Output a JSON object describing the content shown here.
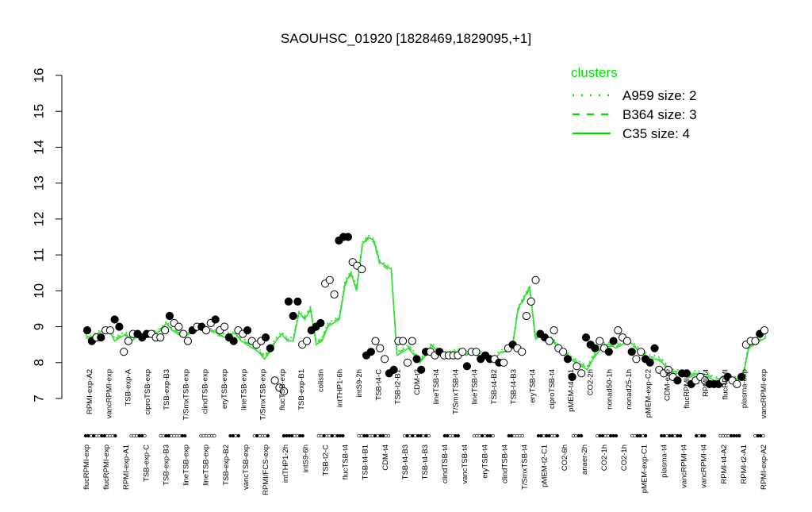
{
  "chart_data": {
    "type": "line",
    "title": "SAOUHSC_01920 [1828469,1829095,+1]",
    "ylim": [
      7,
      16
    ],
    "yticks": [
      7,
      8,
      9,
      10,
      11,
      12,
      13,
      14,
      15,
      16
    ],
    "grid": false,
    "legend_position": "top-right",
    "legend": {
      "title": "clusters",
      "color": "#00dd00",
      "entries": [
        {
          "label": "A959 size: 2",
          "style": "dotted"
        },
        {
          "label": "B364 size: 3",
          "style": "dashed"
        },
        {
          "label": "C35 size: 4",
          "style": "solid"
        }
      ]
    },
    "line_color": "#33dd33",
    "labels_upper": [
      "RPMI-exp-A2",
      "vancRPMI-exp",
      "TSB-exp-A",
      "ciproTSB-exp",
      "TSB-exp-B3",
      "T/SmxTSB-exp",
      "clindTSB-exp",
      "eryTSB-exp",
      "lineTSB-exp",
      "T/SmxTSB-exp",
      "flucTSB-exp",
      "TSB-exp-B1",
      "colistin",
      "intTHP1-6h",
      "intS9-2h",
      "TSB-t4-C",
      "TSB-t2-B1",
      "CDM-t2",
      "lineTSB-t4",
      "T/SmxTSB-t4",
      "lineTSB-t4",
      "TSB-t4-B2",
      "TSB-t4-B3",
      "eryTSB-t4",
      "ciproTSB-t4",
      "pMEM-t4-C1",
      "CO2-2h",
      "nonad50-1h",
      "nonad25-1h",
      "pMEM-exp-C2",
      "CDM-exp",
      "flucRPMI-t4",
      "RPMI-t4",
      "flucRPMI",
      "plasma-exp",
      "vancRPMI-exp"
    ],
    "labels_lower": [
      "flucRPMI-exp",
      "flucRPMI-exp",
      "RPMI-exp-A1",
      "TSB-exp-C",
      "TSB-exp-B3",
      "lineTSB-exp",
      "lineTSB-exp",
      "TSB-exp-B2",
      "vancTSB-exp",
      "RPMI/FCS-exp",
      "intTHP1-2h",
      "intS9-6h",
      "TSB-t2-C",
      "flucTSB-t4",
      "TSB-t4-B1",
      "CDM-t4",
      "TSB-t4-B3",
      "TSB-t4-B3",
      "clindTSB-t4",
      "vancTSB-t4",
      "eryTSB-t4",
      "clindTSB-t4",
      "T/SmxTSB-t4",
      "pMEM-t2-C1",
      "CO2-6h",
      "anaer-2h",
      "CO2-1h",
      "CO2-1h",
      "pMEM-exp-C1",
      "plasma-t4",
      "vancRPMI-t4",
      "vancRPMI-t4",
      "RPMI-t4-A2",
      "RPMI-t2-A1",
      "RPMI-exp-A2"
    ],
    "series": [
      {
        "style": "solid",
        "values": [
          8.75,
          8.7,
          8.8,
          8.9,
          8.95,
          8.6,
          8.7,
          8.8,
          8.6,
          8.75,
          8.7,
          8.7,
          8.8,
          8.9,
          9.1,
          8.9,
          8.8,
          8.7,
          8.8,
          8.9,
          9.0,
          8.9,
          8.9,
          8.8,
          8.7,
          8.8,
          8.8,
          8.6,
          8.5,
          8.4,
          8.3,
          8.1,
          8.3,
          8.6,
          8.8,
          8.6,
          8.6,
          9.4,
          9.2,
          9.5,
          8.5,
          8.6,
          9.0,
          9.1,
          9.2,
          10.2,
          10.5,
          10.0,
          11.3,
          11.5,
          11.4,
          10.8,
          10.7,
          10.6,
          8.2,
          8.3,
          8.4,
          8.2,
          8.0,
          8.2,
          8.5,
          8.3,
          8.2,
          8.2,
          8.3,
          8.3,
          8.2,
          8.3,
          8.2,
          8.2,
          8.1,
          8.1,
          8.3,
          8.3,
          8.4,
          9.5,
          9.8,
          10.1,
          8.7,
          8.8,
          8.7,
          8.6,
          8.4,
          8.3,
          8.1,
          8.0,
          7.9,
          7.8,
          8.1,
          8.3,
          8.5,
          8.5,
          8.4,
          8.5,
          8.6,
          8.5,
          8.3,
          8.2,
          8.1,
          8.1,
          8.0,
          7.8,
          7.7,
          7.7,
          7.6,
          7.6,
          7.7,
          7.6,
          7.6,
          7.5,
          7.5,
          7.5,
          7.5,
          7.5,
          7.6,
          8.4,
          8.5,
          8.6,
          8.7
        ]
      },
      {
        "style": "dashed",
        "values": [
          8.7,
          8.65,
          8.75,
          8.85,
          8.9,
          8.65,
          8.75,
          8.75,
          8.65,
          8.7,
          8.75,
          8.75,
          8.85,
          8.95,
          9.05,
          8.95,
          8.85,
          8.75,
          8.85,
          8.85,
          8.95,
          8.95,
          8.85,
          8.75,
          8.75,
          8.75,
          8.75,
          8.65,
          8.55,
          8.45,
          8.35,
          8.15,
          8.35,
          8.65,
          8.75,
          8.65,
          8.65,
          9.35,
          9.25,
          9.45,
          8.55,
          8.65,
          9.05,
          9.15,
          9.25,
          10.15,
          10.45,
          10.05,
          11.25,
          11.45,
          11.35,
          10.75,
          10.65,
          10.55,
          8.25,
          8.35,
          8.45,
          8.25,
          8.05,
          8.25,
          8.45,
          8.35,
          8.25,
          8.25,
          8.35,
          8.35,
          8.25,
          8.25,
          8.25,
          8.25,
          8.15,
          8.15,
          8.25,
          8.35,
          8.45,
          9.45,
          9.75,
          10.05,
          8.65,
          8.75,
          8.65,
          8.65,
          8.45,
          8.35,
          8.15,
          8.05,
          7.95,
          7.85,
          8.15,
          8.35,
          8.45,
          8.45,
          8.45,
          8.55,
          8.55,
          8.45,
          8.35,
          8.25,
          8.15,
          8.15,
          8.05,
          7.85,
          7.75,
          7.75,
          7.65,
          7.65,
          7.75,
          7.65,
          7.65,
          7.55,
          7.55,
          7.55,
          7.55,
          7.55,
          7.65,
          8.45,
          8.55,
          8.65,
          8.75
        ]
      },
      {
        "style": "dotted",
        "values": [
          8.8,
          8.75,
          8.85,
          8.95,
          8.9,
          8.7,
          8.8,
          8.85,
          8.7,
          8.8,
          8.8,
          8.75,
          8.9,
          8.95,
          9.15,
          8.95,
          8.85,
          8.8,
          8.85,
          8.95,
          9.0,
          8.95,
          8.95,
          8.85,
          8.8,
          8.85,
          8.85,
          8.7,
          8.6,
          8.5,
          8.4,
          8.2,
          8.4,
          8.7,
          8.85,
          8.7,
          8.7,
          9.45,
          9.3,
          9.55,
          8.6,
          8.7,
          9.1,
          9.2,
          9.3,
          10.3,
          10.55,
          10.1,
          11.35,
          11.55,
          11.45,
          10.85,
          10.75,
          10.65,
          8.3,
          8.4,
          8.5,
          8.3,
          8.1,
          8.3,
          8.55,
          8.4,
          8.3,
          8.3,
          8.35,
          8.4,
          8.3,
          8.35,
          8.3,
          8.3,
          8.2,
          8.2,
          8.35,
          8.4,
          8.5,
          9.55,
          9.85,
          10.15,
          8.75,
          8.85,
          8.75,
          8.7,
          8.5,
          8.4,
          8.2,
          8.1,
          8.0,
          7.9,
          8.2,
          8.4,
          8.55,
          8.55,
          8.5,
          8.6,
          8.65,
          8.55,
          8.4,
          8.3,
          8.2,
          8.2,
          8.1,
          7.9,
          7.8,
          7.8,
          7.7,
          7.7,
          7.8,
          7.7,
          7.7,
          7.6,
          7.6,
          7.6,
          7.6,
          7.6,
          7.7,
          8.5,
          8.6,
          8.7,
          8.8
        ]
      }
    ],
    "points": [
      {
        "v": 8.9,
        "f": 1
      },
      {
        "v": 8.6,
        "f": 1
      },
      {
        "v": 8.7,
        "f": 0
      },
      {
        "v": 8.7,
        "f": 1
      },
      {
        "v": 8.9,
        "f": 0
      },
      {
        "v": 8.9,
        "f": 0
      },
      {
        "v": 9.2,
        "f": 1
      },
      {
        "v": 9.0,
        "f": 1
      },
      {
        "v": 8.3,
        "f": 0
      },
      {
        "v": 8.6,
        "f": 0
      },
      {
        "v": 8.8,
        "f": 0
      },
      {
        "v": 8.8,
        "f": 1
      },
      {
        "v": 8.7,
        "f": 1
      },
      {
        "v": 8.8,
        "f": 1
      },
      {
        "v": 8.8,
        "f": 0
      },
      {
        "v": 8.7,
        "f": 0
      },
      {
        "v": 8.7,
        "f": 0
      },
      {
        "v": 8.9,
        "f": 0
      },
      {
        "v": 9.3,
        "f": 1
      },
      {
        "v": 9.1,
        "f": 0
      },
      {
        "v": 9.0,
        "f": 0
      },
      {
        "v": 8.8,
        "f": 0
      },
      {
        "v": 8.6,
        "f": 0
      },
      {
        "v": 8.9,
        "f": 1
      },
      {
        "v": 9.0,
        "f": 0
      },
      {
        "v": 9.0,
        "f": 1
      },
      {
        "v": 8.9,
        "f": 0
      },
      {
        "v": 9.1,
        "f": 0
      },
      {
        "v": 9.2,
        "f": 1
      },
      {
        "v": 8.9,
        "f": 0
      },
      {
        "v": 9.0,
        "f": 0
      },
      {
        "v": 8.7,
        "f": 1
      },
      {
        "v": 8.6,
        "f": 1
      },
      {
        "v": 8.9,
        "f": 0
      },
      {
        "v": 8.8,
        "f": 0
      },
      {
        "v": 8.9,
        "f": 1
      },
      {
        "v": 8.6,
        "f": 0
      },
      {
        "v": 8.5,
        "f": 0
      },
      {
        "v": 8.6,
        "f": 0
      },
      {
        "v": 8.7,
        "f": 1
      },
      {
        "v": 8.4,
        "f": 1
      },
      {
        "v": 7.5,
        "f": 0
      },
      {
        "v": 7.3,
        "f": 0
      },
      {
        "v": 7.2,
        "f": 0
      },
      {
        "v": 9.7,
        "f": 1
      },
      {
        "v": 9.3,
        "f": 1
      },
      {
        "v": 9.7,
        "f": 1
      },
      {
        "v": 8.5,
        "f": 0
      },
      {
        "v": 8.6,
        "f": 0
      },
      {
        "v": 8.9,
        "f": 1
      },
      {
        "v": 9.0,
        "f": 1
      },
      {
        "v": 9.1,
        "f": 1
      },
      {
        "v": 10.2,
        "f": 0
      },
      {
        "v": 10.3,
        "f": 0
      },
      {
        "v": 9.9,
        "f": 0
      },
      {
        "v": 11.4,
        "f": 1
      },
      {
        "v": 11.5,
        "f": 1
      },
      {
        "v": 11.5,
        "f": 1
      },
      {
        "v": 10.8,
        "f": 0
      },
      {
        "v": 10.7,
        "f": 0
      },
      {
        "v": 10.6,
        "f": 0
      },
      {
        "v": 8.2,
        "f": 1
      },
      {
        "v": 8.3,
        "f": 1
      },
      {
        "v": 8.6,
        "f": 0
      },
      {
        "v": 8.4,
        "f": 0
      },
      {
        "v": 8.1,
        "f": 0
      },
      {
        "v": 7.7,
        "f": 1
      },
      {
        "v": 7.8,
        "f": 1
      },
      {
        "v": 8.6,
        "f": 0
      },
      {
        "v": 8.6,
        "f": 0
      },
      {
        "v": 8.0,
        "f": 0
      },
      {
        "v": 8.6,
        "f": 0
      },
      {
        "v": 8.1,
        "f": 1
      },
      {
        "v": 7.8,
        "f": 1
      },
      {
        "v": 8.3,
        "f": 1
      },
      {
        "v": 8.3,
        "f": 0
      },
      {
        "v": 8.2,
        "f": 0
      },
      {
        "v": 8.3,
        "f": 1
      },
      {
        "v": 8.2,
        "f": 0
      },
      {
        "v": 8.2,
        "f": 0
      },
      {
        "v": 8.2,
        "f": 0
      },
      {
        "v": 8.2,
        "f": 0
      },
      {
        "v": 8.3,
        "f": 0
      },
      {
        "v": 7.9,
        "f": 1
      },
      {
        "v": 8.3,
        "f": 0
      },
      {
        "v": 8.3,
        "f": 0
      },
      {
        "v": 8.1,
        "f": 1
      },
      {
        "v": 8.2,
        "f": 1
      },
      {
        "v": 8.1,
        "f": 1
      },
      {
        "v": 8.1,
        "f": 0
      },
      {
        "v": 8.0,
        "f": 1
      },
      {
        "v": 8.0,
        "f": 0
      },
      {
        "v": 8.4,
        "f": 0
      },
      {
        "v": 8.5,
        "f": 1
      },
      {
        "v": 8.4,
        "f": 0
      },
      {
        "v": 8.3,
        "f": 0
      },
      {
        "v": 9.3,
        "f": 0
      },
      {
        "v": 9.7,
        "f": 0
      },
      {
        "v": 10.3,
        "f": 0
      },
      {
        "v": 8.8,
        "f": 1
      },
      {
        "v": 8.7,
        "f": 1
      },
      {
        "v": 8.6,
        "f": 0
      },
      {
        "v": 8.9,
        "f": 0
      },
      {
        "v": 8.4,
        "f": 0
      },
      {
        "v": 8.3,
        "f": 0
      },
      {
        "v": 8.1,
        "f": 1
      },
      {
        "v": 7.6,
        "f": 1
      },
      {
        "v": 7.9,
        "f": 0
      },
      {
        "v": 7.7,
        "f": 0
      },
      {
        "v": 8.7,
        "f": 1
      },
      {
        "v": 8.5,
        "f": 1
      },
      {
        "v": 8.4,
        "f": 1
      },
      {
        "v": 8.6,
        "f": 0
      },
      {
        "v": 8.4,
        "f": 0
      },
      {
        "v": 8.3,
        "f": 1
      },
      {
        "v": 8.6,
        "f": 1
      },
      {
        "v": 8.9,
        "f": 0
      },
      {
        "v": 8.7,
        "f": 0
      },
      {
        "v": 8.6,
        "f": 0
      },
      {
        "v": 8.3,
        "f": 1
      },
      {
        "v": 8.1,
        "f": 0
      },
      {
        "v": 8.3,
        "f": 0
      },
      {
        "v": 8.1,
        "f": 1
      },
      {
        "v": 8.0,
        "f": 1
      },
      {
        "v": 8.4,
        "f": 1
      },
      {
        "v": 7.8,
        "f": 0
      },
      {
        "v": 7.7,
        "f": 0
      },
      {
        "v": 7.8,
        "f": 0
      },
      {
        "v": 7.6,
        "f": 0
      },
      {
        "v": 7.5,
        "f": 1
      },
      {
        "v": 7.7,
        "f": 1
      },
      {
        "v": 7.7,
        "f": 1
      },
      {
        "v": 7.4,
        "f": 1
      },
      {
        "v": 7.5,
        "f": 0
      },
      {
        "v": 7.6,
        "f": 0
      },
      {
        "v": 7.5,
        "f": 0
      },
      {
        "v": 7.4,
        "f": 1
      },
      {
        "v": 7.4,
        "f": 1
      },
      {
        "v": 7.4,
        "f": 1
      },
      {
        "v": 7.5,
        "f": 0
      },
      {
        "v": 7.6,
        "f": 1
      },
      {
        "v": 7.5,
        "f": 0
      },
      {
        "v": 7.4,
        "f": 0
      },
      {
        "v": 7.6,
        "f": 1
      },
      {
        "v": 8.5,
        "f": 0
      },
      {
        "v": 8.6,
        "f": 0
      },
      {
        "v": 8.6,
        "f": 0
      },
      {
        "v": 8.8,
        "f": 1
      },
      {
        "v": 8.9,
        "f": 0
      }
    ],
    "rug": [
      {
        "n": 12,
        "f": [
          1,
          1,
          0,
          1,
          0,
          0,
          1,
          1,
          0,
          0,
          0,
          1
        ]
      },
      {
        "n": 6,
        "f": [
          0,
          0,
          0,
          1,
          1,
          0
        ]
      },
      {
        "n": 10,
        "f": [
          0,
          0,
          1,
          1,
          0,
          0,
          0,
          0,
          1,
          1
        ]
      },
      {
        "n": 6,
        "f": [
          0,
          0,
          0,
          0,
          0,
          0
        ]
      },
      {
        "n": 4,
        "f": [
          1,
          1,
          0,
          1
        ]
      },
      {
        "n": 6,
        "f": [
          0,
          1,
          0,
          0,
          0,
          1
        ]
      },
      {
        "n": 8,
        "f": [
          1,
          1,
          1,
          1,
          0,
          0,
          1,
          1
        ]
      },
      {
        "n": 10,
        "f": [
          0,
          0,
          1,
          0,
          0,
          1,
          0,
          1,
          1,
          1
        ]
      },
      {
        "n": 12,
        "f": [
          0,
          0,
          1,
          1,
          0,
          0,
          1,
          0,
          1,
          1,
          0,
          0
        ]
      },
      {
        "n": 10,
        "f": [
          0,
          1,
          0,
          1,
          0,
          1,
          1,
          0,
          1,
          0
        ]
      },
      {
        "n": 6,
        "f": [
          1,
          1,
          0,
          0,
          1,
          1
        ]
      },
      {
        "n": 8,
        "f": [
          0,
          0,
          0,
          1,
          0,
          1,
          1,
          0
        ]
      },
      {
        "n": 6,
        "f": [
          1,
          1,
          0,
          0,
          0,
          0
        ]
      },
      {
        "n": 8,
        "f": [
          1,
          1,
          0,
          1,
          1,
          0,
          0,
          1
        ]
      },
      {
        "n": 4,
        "f": [
          0,
          0,
          1,
          1
        ]
      },
      {
        "n": 8,
        "f": [
          0,
          1,
          1,
          0,
          0,
          1,
          1,
          1
        ]
      },
      {
        "n": 6,
        "f": [
          0,
          0,
          1,
          1,
          0,
          1
        ]
      },
      {
        "n": 8,
        "f": [
          1,
          1,
          0,
          1,
          1,
          0,
          1,
          1
        ]
      },
      {
        "n": 4,
        "f": [
          1,
          0,
          1,
          1
        ]
      },
      {
        "n": 8,
        "f": [
          0,
          0,
          0,
          0,
          1,
          1,
          1,
          1
        ]
      },
      {
        "n": 4,
        "f": [
          0,
          1,
          1,
          0
        ]
      }
    ]
  }
}
